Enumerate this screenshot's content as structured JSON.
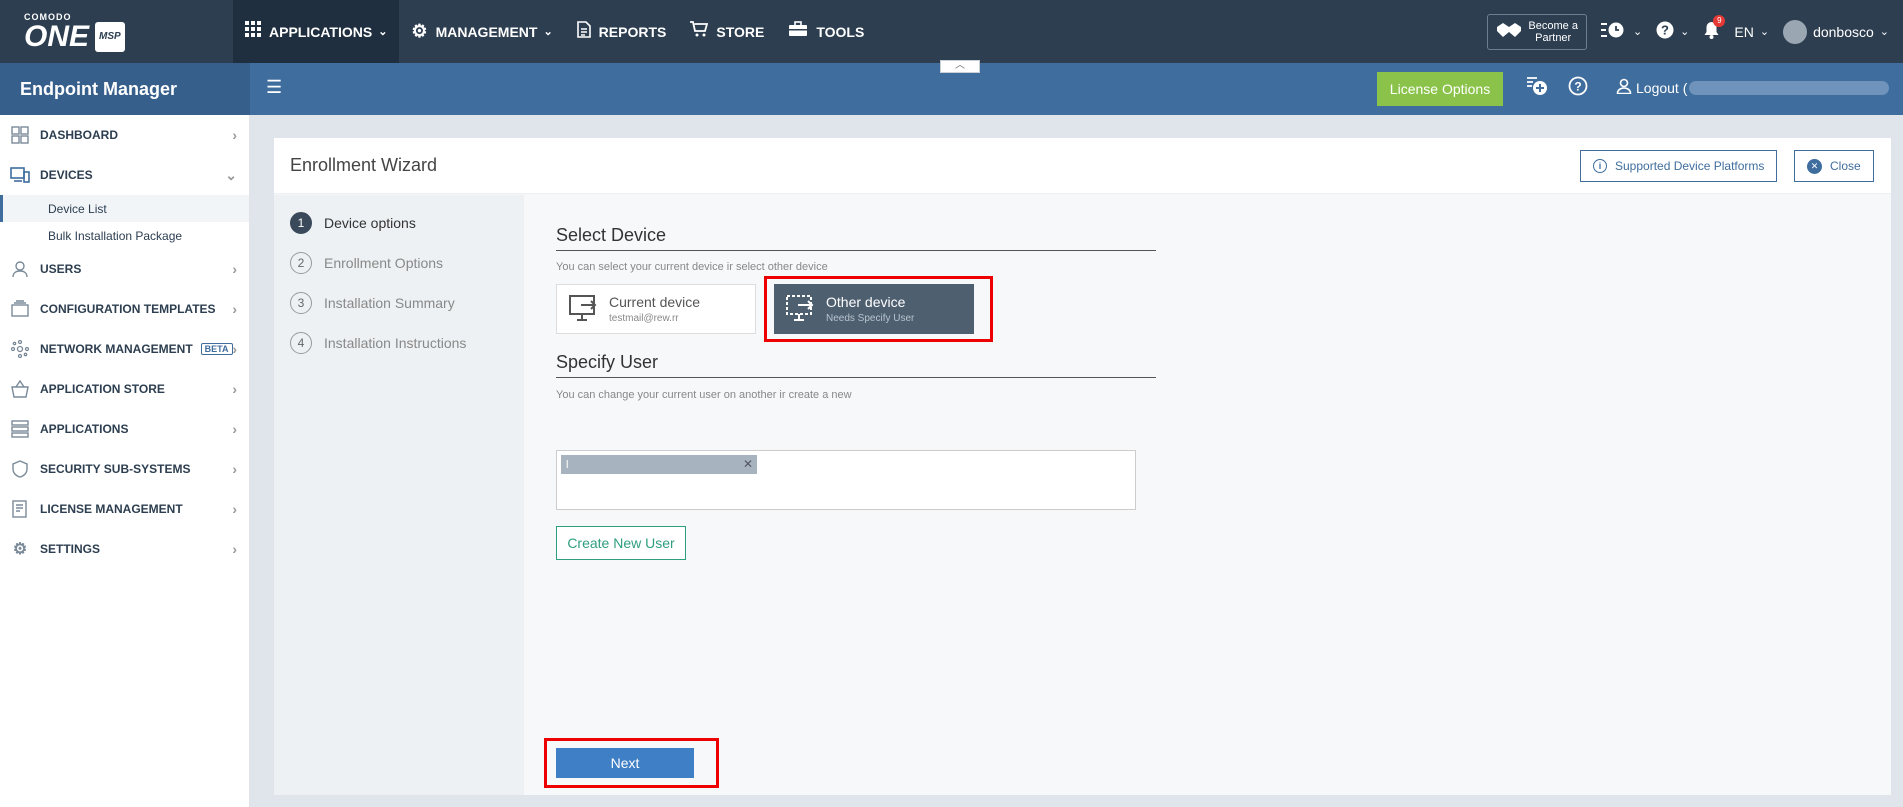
{
  "topbar": {
    "logo_small": "COMODO",
    "logo_big": "ONE",
    "logo_tag": "MSP",
    "nav": [
      {
        "label": "APPLICATIONS",
        "icon": "grid-icon",
        "active": true,
        "caret": true
      },
      {
        "label": "MANAGEMENT",
        "icon": "gear-icon",
        "active": false,
        "caret": true
      },
      {
        "label": "REPORTS",
        "icon": "document-icon",
        "active": false,
        "caret": false
      },
      {
        "label": "STORE",
        "icon": "cart-icon",
        "active": false,
        "caret": false
      },
      {
        "label": "TOOLS",
        "icon": "toolbox-icon",
        "active": false,
        "caret": false
      }
    ],
    "partner_line1": "Become a",
    "partner_line2": "Partner",
    "notifications_count": "9",
    "language": "EN",
    "username": "donbosco"
  },
  "secbar": {
    "app_title": "Endpoint Manager",
    "license_button": "License Options",
    "logout_label": "Logout ("
  },
  "sidebar": {
    "items": [
      {
        "label": "DASHBOARD",
        "icon": "dashboard-icon"
      },
      {
        "label": "DEVICES",
        "icon": "devices-icon"
      },
      {
        "label": "USERS",
        "icon": "user-icon"
      },
      {
        "label": "CONFIGURATION TEMPLATES",
        "icon": "templates-icon"
      },
      {
        "label": "NETWORK MANAGEMENT",
        "icon": "network-icon",
        "badge": "BETA"
      },
      {
        "label": "APPLICATION STORE",
        "icon": "basket-icon"
      },
      {
        "label": "APPLICATIONS",
        "icon": "applications-icon"
      },
      {
        "label": "SECURITY SUB-SYSTEMS",
        "icon": "shield-icon"
      },
      {
        "label": "LICENSE MANAGEMENT",
        "icon": "license-icon"
      },
      {
        "label": "SETTINGS",
        "icon": "settings-icon"
      }
    ],
    "devices_sub": [
      "Device List",
      "Bulk Installation Package"
    ]
  },
  "wizard": {
    "title": "Enrollment Wizard",
    "supported_button": "Supported Device Platforms",
    "close_button": "Close",
    "steps": [
      {
        "num": "1",
        "label": "Device options",
        "active": true
      },
      {
        "num": "2",
        "label": "Enrollment Options",
        "active": false
      },
      {
        "num": "3",
        "label": "Installation Summary",
        "active": false
      },
      {
        "num": "4",
        "label": "Installation Instructions",
        "active": false
      }
    ],
    "select_device_title": "Select Device",
    "select_device_hint": "You can select your current device ir select other device",
    "current_device_name": "Current device",
    "current_device_sub": "testmail@rew.rr",
    "other_device_name": "Other device",
    "other_device_sub": "Needs Specify User",
    "specify_user_title": "Specify User",
    "specify_user_hint": "You can change your current user on another ir create a new",
    "user_chip": "l",
    "create_user_button": "Create New User",
    "next_button": "Next"
  }
}
